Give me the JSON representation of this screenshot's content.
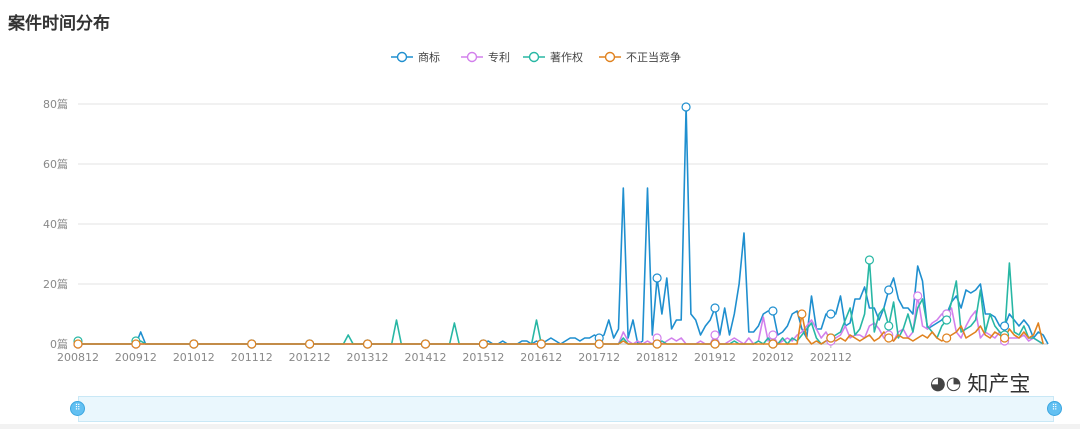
{
  "page": {
    "title": "案件时间分布"
  },
  "watermark": {
    "text": "知产宝"
  },
  "chart_data": {
    "type": "line",
    "title": "",
    "xlabel": "",
    "ylabel": "",
    "ylim": [
      0,
      80
    ],
    "y_ticks": [
      0,
      20,
      40,
      60,
      80
    ],
    "y_unit": "篇",
    "x_tick_labels": [
      "200812",
      "200912",
      "201012",
      "201112",
      "201212",
      "201312",
      "201412",
      "201512",
      "201612",
      "201712",
      "201812",
      "201912",
      "202012",
      "202112"
    ],
    "x_start": "2008-12",
    "grid": true,
    "legend_position": "top-center",
    "series": [
      {
        "name": "商标",
        "color": "#1f8fcf",
        "values": [
          0,
          0,
          0,
          0,
          0,
          0,
          0,
          0,
          0,
          0,
          0,
          0,
          0,
          4,
          0,
          0,
          0,
          0,
          0,
          0,
          0,
          0,
          0,
          0,
          0,
          0,
          0,
          0,
          0,
          0,
          0,
          0,
          0,
          0,
          0,
          0,
          0,
          0,
          0,
          0,
          0,
          0,
          0,
          0,
          0,
          0,
          0,
          0,
          0,
          0,
          0,
          0,
          0,
          0,
          0,
          0,
          0,
          0,
          0,
          0,
          0,
          0,
          0,
          0,
          0,
          0,
          0,
          0,
          0,
          0,
          0,
          0,
          0,
          0,
          0,
          0,
          0,
          0,
          0,
          0,
          0,
          0,
          0,
          0,
          0,
          1,
          0,
          0,
          1,
          0,
          0,
          0,
          1,
          1,
          0,
          1,
          0,
          1,
          2,
          1,
          0,
          1,
          2,
          2,
          1,
          2,
          2,
          3,
          2,
          3,
          8,
          2,
          5,
          52,
          2,
          8,
          0,
          1,
          52,
          3,
          22,
          10,
          22,
          5,
          8,
          8,
          79,
          10,
          8,
          3,
          6,
          8,
          12,
          3,
          12,
          3,
          10,
          20,
          37,
          4,
          4,
          6,
          10,
          11,
          11,
          3,
          4,
          6,
          10,
          11,
          5,
          2,
          16,
          5,
          5,
          10,
          10,
          10,
          16,
          6,
          7,
          15,
          15,
          19,
          12,
          12,
          8,
          12,
          18,
          22,
          15,
          12,
          12,
          10,
          26,
          21,
          5,
          6,
          7,
          8,
          10,
          14,
          16,
          12,
          18,
          17,
          18,
          20,
          10,
          10,
          9,
          6,
          6,
          10,
          8,
          6,
          8,
          6,
          2,
          4,
          3,
          0
        ]
      },
      {
        "name": "专利",
        "color": "#d280ec",
        "values": [
          0,
          0,
          0,
          0,
          0,
          0,
          0,
          0,
          0,
          0,
          0,
          0,
          0,
          0,
          0,
          0,
          0,
          0,
          0,
          0,
          0,
          0,
          0,
          0,
          0,
          0,
          0,
          0,
          0,
          0,
          0,
          0,
          0,
          0,
          0,
          0,
          0,
          0,
          0,
          0,
          0,
          0,
          0,
          0,
          0,
          0,
          0,
          0,
          0,
          0,
          0,
          0,
          0,
          0,
          0,
          0,
          0,
          0,
          0,
          0,
          0,
          0,
          0,
          0,
          0,
          0,
          0,
          0,
          0,
          0,
          0,
          0,
          0,
          0,
          0,
          0,
          0,
          0,
          0,
          0,
          0,
          0,
          0,
          0,
          0,
          0,
          0,
          0,
          0,
          0,
          0,
          0,
          0,
          0,
          0,
          0,
          0,
          0,
          0,
          0,
          0,
          0,
          0,
          0,
          0,
          0,
          0,
          0,
          0,
          0,
          0,
          0,
          0,
          4,
          1,
          0,
          1,
          0,
          1,
          0,
          2,
          0,
          1,
          2,
          1,
          2,
          0,
          0,
          0,
          1,
          0,
          0,
          3,
          0,
          0,
          1,
          2,
          1,
          0,
          2,
          0,
          1,
          9,
          1,
          3,
          0,
          1,
          2,
          1,
          3,
          4,
          6,
          8,
          5,
          2,
          4,
          1,
          2,
          3,
          6,
          2,
          3,
          3,
          2,
          6,
          7,
          5,
          2,
          3,
          1,
          4,
          5,
          2,
          4,
          16,
          6,
          5,
          7,
          8,
          10,
          10,
          12,
          4,
          2,
          6,
          9,
          11,
          2,
          4,
          3,
          2,
          4,
          1,
          2,
          2,
          2,
          3,
          1,
          2,
          1,
          0
        ]
      },
      {
        "name": "著作权",
        "color": "#28b7a4",
        "values": [
          1,
          0,
          0,
          0,
          0,
          0,
          0,
          0,
          0,
          0,
          0,
          0,
          1,
          1,
          0,
          0,
          0,
          0,
          0,
          0,
          0,
          0,
          0,
          0,
          0,
          0,
          0,
          0,
          0,
          0,
          0,
          0,
          0,
          0,
          0,
          0,
          0,
          0,
          0,
          0,
          0,
          0,
          0,
          0,
          0,
          0,
          0,
          0,
          0,
          0,
          0,
          0,
          0,
          0,
          0,
          0,
          3,
          0,
          0,
          0,
          0,
          0,
          0,
          0,
          0,
          0,
          8,
          0,
          0,
          0,
          0,
          0,
          0,
          0,
          0,
          0,
          0,
          0,
          7,
          0,
          0,
          0,
          0,
          0,
          0,
          0,
          0,
          0,
          0,
          0,
          0,
          0,
          0,
          0,
          0,
          8,
          0,
          0,
          0,
          0,
          0,
          0,
          0,
          0,
          0,
          0,
          0,
          0,
          0,
          0,
          0,
          0,
          0,
          2,
          0,
          0,
          0,
          0,
          0,
          0,
          0,
          1,
          0,
          0,
          0,
          0,
          0,
          0,
          0,
          0,
          0,
          0,
          0,
          0,
          0,
          0,
          1,
          0,
          0,
          0,
          0,
          1,
          0,
          2,
          0,
          0,
          2,
          0,
          2,
          1,
          3,
          5,
          7,
          2,
          0,
          1,
          2,
          3,
          4,
          8,
          12,
          3,
          5,
          10,
          28,
          4,
          10,
          12,
          6,
          14,
          2,
          5,
          10,
          4,
          12,
          15,
          6,
          4,
          2,
          6,
          8,
          14,
          21,
          4,
          5,
          6,
          8,
          18,
          4,
          10,
          6,
          4,
          3,
          27,
          4,
          3,
          6,
          2,
          2,
          1,
          0
        ]
      },
      {
        "name": "不正当竞争",
        "color": "#e0821f",
        "values": [
          0,
          0,
          0,
          0,
          0,
          0,
          0,
          0,
          0,
          0,
          0,
          0,
          0,
          0,
          0,
          0,
          0,
          0,
          0,
          0,
          0,
          0,
          0,
          0,
          0,
          0,
          0,
          0,
          0,
          0,
          0,
          0,
          0,
          0,
          0,
          0,
          0,
          0,
          0,
          0,
          0,
          0,
          0,
          0,
          0,
          0,
          0,
          0,
          0,
          0,
          0,
          0,
          0,
          0,
          0,
          0,
          0,
          0,
          0,
          0,
          0,
          0,
          0,
          0,
          0,
          0,
          0,
          0,
          0,
          0,
          0,
          0,
          0,
          0,
          0,
          0,
          0,
          0,
          0,
          0,
          0,
          0,
          0,
          0,
          0,
          0,
          0,
          0,
          0,
          0,
          0,
          0,
          0,
          0,
          0,
          0,
          0,
          0,
          0,
          0,
          0,
          0,
          0,
          0,
          0,
          0,
          0,
          0,
          0,
          0,
          0,
          0,
          0,
          1,
          0,
          0,
          0,
          0,
          0,
          0,
          0,
          0,
          0,
          0,
          0,
          0,
          0,
          0,
          0,
          0,
          0,
          0,
          0,
          0,
          0,
          0,
          0,
          0,
          0,
          0,
          0,
          0,
          0,
          0,
          0,
          0,
          0,
          0,
          0,
          0,
          10,
          2,
          0,
          1,
          0,
          1,
          2,
          1,
          2,
          1,
          3,
          2,
          1,
          2,
          3,
          1,
          2,
          4,
          2,
          1,
          3,
          2,
          2,
          1,
          2,
          3,
          2,
          4,
          2,
          1,
          2,
          3,
          4,
          6,
          2,
          3,
          4,
          6,
          3,
          2,
          4,
          3,
          2,
          5,
          3,
          2,
          4,
          2,
          3,
          7,
          0
        ]
      }
    ]
  }
}
